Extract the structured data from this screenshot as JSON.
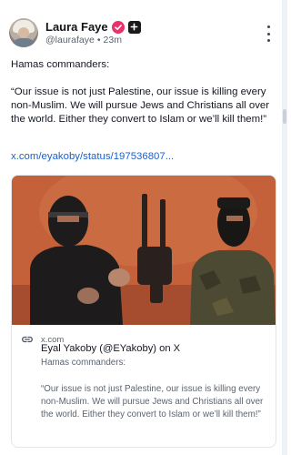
{
  "post": {
    "author_name": "Laura Faye",
    "handle": "@laurafaye",
    "separator": "•",
    "time": "23m",
    "text_line1": "Hamas commanders:",
    "text_quote": "“Our issue is not just Palestine, our issue is killing every non-Muslim. We will pursue Jews and Christians all over the world. Either they convert to Islam or we’ll kill them!”",
    "link_text": "x.com/eyakoby/status/197536807..."
  },
  "card": {
    "domain": "x.com",
    "title": "Eyal Yakoby (@EYakoby) on X",
    "subtitle": "Hamas commanders:",
    "description": "“Our issue is not just Palestine, our issue is killing every non-Muslim. We will pursue Jews and Christians all over the world. Either they convert to Islam or we’ll kill them!”"
  },
  "icons": {
    "verified": "verified-badge-icon",
    "subscription": "plus-badge-icon",
    "more": "more-options-icon",
    "link": "link-icon"
  },
  "colors": {
    "verified_badge": "#e8326b",
    "link": "#1e60c9",
    "muted_text": "#5b6470",
    "media_background": "#c35d36"
  }
}
